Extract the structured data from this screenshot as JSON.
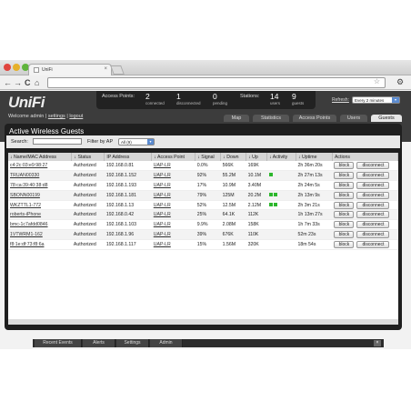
{
  "browser": {
    "tab_title": "UniFi",
    "tab_close": "×",
    "back": "←",
    "forward": "→",
    "reload": "C",
    "home": "⌂",
    "star": "☆",
    "wrench": "🔧"
  },
  "header": {
    "logo": "UniFi",
    "welcome": "Welcome admin",
    "settings": "settings",
    "logout": "logout",
    "access_points_label": "Access Points:",
    "connected_num": "2",
    "connected_label": "connected",
    "disconnected_num": "1",
    "disconnected_label": "disconnected",
    "pending_num": "0",
    "pending_label": "pending",
    "stations_label": "Stations:",
    "users_num": "14",
    "users_label": "users",
    "guests_num": "9",
    "guests_label": "guests",
    "refresh_label": "Refresh:",
    "refresh_value": "Every 2 minutes"
  },
  "nav": [
    "Map",
    "Statistics",
    "Access Points",
    "Users",
    "Guests"
  ],
  "panel": {
    "title": "Active Wireless Guests",
    "search_label": "Search:",
    "search_value": "",
    "filter_label": "Filter by AP",
    "filter_value": "All (9)"
  },
  "table": {
    "headers": [
      "↓ Name/MAC Address",
      "↓ Status",
      "IP Address",
      "↓ Access Point",
      "↓ Signal",
      "↓ Down",
      "↓ Up",
      "↓ Activity",
      "↓ Uptime",
      "Actions"
    ],
    "rows": [
      {
        "name": "c4:2c:03:e9:98:27",
        "status": "Authorized",
        "ip": "192.168.0.81",
        "ap": "UAP-LR",
        "signal": "0.0%",
        "down": "566K",
        "up": "169K",
        "activity": 0,
        "uptime": "2h 36m 20s"
      },
      {
        "name": "TRUAN00330",
        "status": "Authorized",
        "ip": "192.168.1.152",
        "ap": "UAP-LR",
        "signal": "92%",
        "down": "55.2M",
        "up": "10.1M",
        "activity": 1,
        "uptime": "2h 27m 13s"
      },
      {
        "name": "78:ca:39:40:38:d8",
        "status": "Authorized",
        "ip": "192.168.1.193",
        "ap": "UAP-LR",
        "signal": "17%",
        "down": "10.9M",
        "up": "3.40M",
        "activity": 0,
        "uptime": "2h 24m 5s"
      },
      {
        "name": "SBONN00199",
        "status": "Authorized",
        "ip": "192.168.1.181",
        "ap": "UAP-LR",
        "signal": "79%",
        "down": "125M",
        "up": "20.2M",
        "activity": 2,
        "uptime": "2h 13m 9s"
      },
      {
        "name": "WKZTTL1-772",
        "status": "Authorized",
        "ip": "192.168.1.13",
        "ap": "UAP-LR",
        "signal": "52%",
        "down": "12.5M",
        "up": "2.12M",
        "activity": 2,
        "uptime": "2h 3m 21s"
      },
      {
        "name": "roberts-iPhone",
        "status": "Authorized",
        "ip": "192.168.0.42",
        "ap": "UAP-LR",
        "signal": "25%",
        "down": "64.1K",
        "up": "112K",
        "activity": 0,
        "uptime": "1h 13m 27s"
      },
      {
        "name": "bmc-1c7afdd0846",
        "status": "Authorized",
        "ip": "192.168.1.103",
        "ap": "UAP-LR",
        "signal": "9.9%",
        "down": "2.08M",
        "up": "158K",
        "activity": 0,
        "uptime": "1h 7m 33s"
      },
      {
        "name": "1VTWRM1-162",
        "status": "Authorized",
        "ip": "192.168.1.96",
        "ap": "UAP-LR",
        "signal": "39%",
        "down": "676K",
        "up": "110K",
        "activity": 0,
        "uptime": "52m 23s"
      },
      {
        "name": "f8:1e:df:73:f8:6a",
        "status": "Authorized",
        "ip": "192.168.1.117",
        "ap": "UAP-LR",
        "signal": "15%",
        "down": "1.56M",
        "up": "320K",
        "activity": 0,
        "uptime": "18m 54s"
      }
    ],
    "block_label": "block",
    "disconnect_label": "disconnect"
  },
  "bottom": [
    "Recent Events",
    "Alerts",
    "Settings",
    "Admin"
  ],
  "bottom_close": "×"
}
